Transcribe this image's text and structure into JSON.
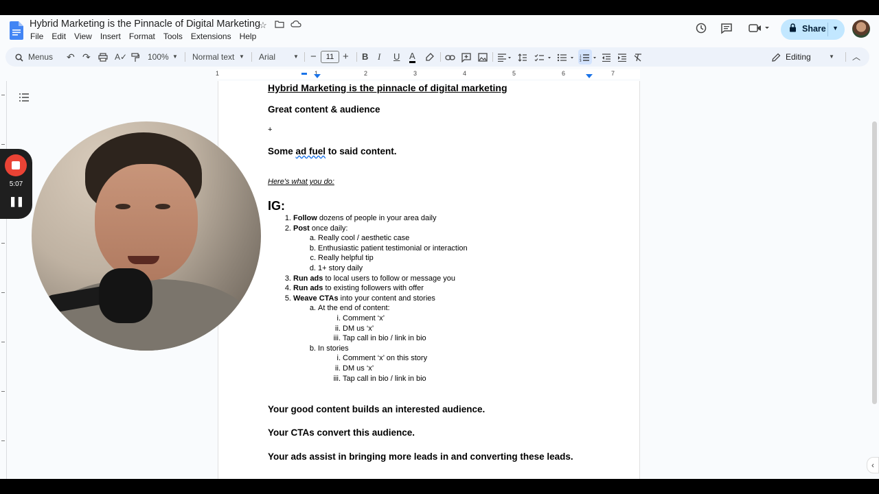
{
  "doc": {
    "title": "Hybrid Marketing is the Pinnacle of Digital Marketing",
    "menus": [
      "File",
      "Edit",
      "View",
      "Insert",
      "Format",
      "Tools",
      "Extensions",
      "Help"
    ]
  },
  "header": {
    "share_label": "Share"
  },
  "toolbar": {
    "search_menus": "Menus",
    "zoom": "100%",
    "style": "Normal text",
    "font": "Arial",
    "font_size": "11",
    "mode": "Editing"
  },
  "ruler": {
    "numbers": [
      "1",
      "1",
      "2",
      "3",
      "4",
      "5",
      "6",
      "7"
    ]
  },
  "recorder": {
    "time": "5:07"
  },
  "content": {
    "heading": "Hybrid Marketing is the pinnacle of digital marketing",
    "line1": "Great content & audience",
    "plus": "+",
    "line2_a": "Some ",
    "line2_b": "ad fuel",
    "line2_c": " to said content.",
    "intro": "Here's what you do:",
    "ig": "IG:",
    "items": [
      {
        "num": "1.",
        "bold": "Follow",
        "rest": " dozens of people in your area daily"
      },
      {
        "num": "2.",
        "bold": "Post",
        "rest": " once daily:"
      },
      {
        "num": "a.",
        "bold": "",
        "rest": "Really cool / aesthetic case"
      },
      {
        "num": "b.",
        "bold": "",
        "rest": "Enthusiastic patient testimonial or interaction"
      },
      {
        "num": "c.",
        "bold": "",
        "rest": "Really helpful tip"
      },
      {
        "num": "d.",
        "bold": "",
        "rest": "1+ story daily"
      },
      {
        "num": "3.",
        "bold": "Run ads",
        "rest": " to local users to follow or message you"
      },
      {
        "num": "4.",
        "bold": "Run ads",
        "rest": " to existing followers with offer"
      },
      {
        "num": "5.",
        "bold": "Weave CTAs",
        "rest": " into your content and stories"
      },
      {
        "num": "a.",
        "bold": "",
        "rest": "At the end of content:"
      },
      {
        "num": "i.",
        "bold": "",
        "rest": "Comment ‘x’"
      },
      {
        "num": "ii.",
        "bold": "",
        "rest": "DM us ‘x’"
      },
      {
        "num": "iii.",
        "bold": "",
        "rest": "Tap call in bio / link in bio"
      },
      {
        "num": "b.",
        "bold": "",
        "rest": "In stories"
      },
      {
        "num": "i.",
        "bold": "",
        "rest": "Comment ‘x’ on this story"
      },
      {
        "num": "ii.",
        "bold": "",
        "rest": "DM us ‘x’"
      },
      {
        "num": "iii.",
        "bold": "",
        "rest": "Tap call in bio / link in bio"
      }
    ],
    "closing1": "Your good content builds an interested audience.",
    "closing2": "Your CTAs convert this audience.",
    "closing3": "Your ads assist in bringing more leads in and converting these leads."
  },
  "colors": {
    "accent": "#c2e7ff",
    "record": "#ea4335",
    "toolbar_bg": "#edf2fa"
  }
}
